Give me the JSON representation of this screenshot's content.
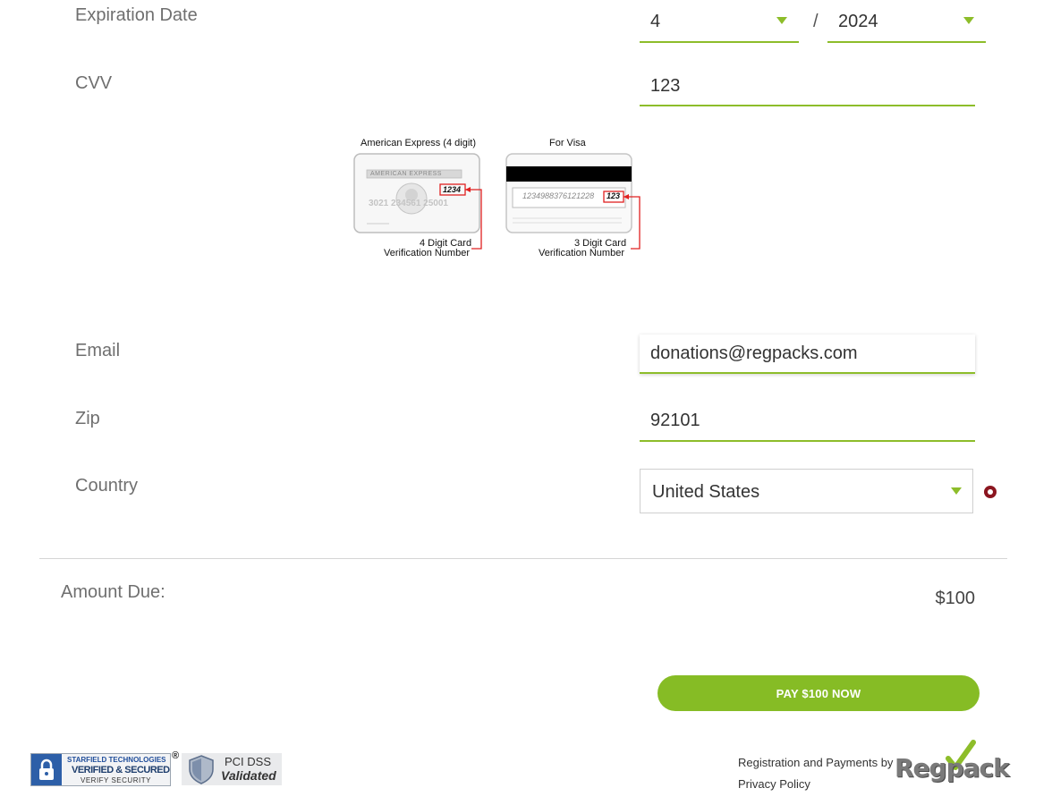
{
  "expiration": {
    "label": "Expiration Date",
    "month": "4",
    "separator": "/",
    "year": "2024"
  },
  "cvv": {
    "label": "CVV",
    "value": "123",
    "amex_title": "American Express (4 digit)",
    "amex_header": "AMERICAN EXPRESS",
    "amex_code": "1234",
    "amex_number": "3021  234561  25001",
    "amex_caption_1": "4 Digit Card",
    "amex_caption_2": "Verification Number",
    "visa_title": "For Visa",
    "visa_number": "1234988376121228",
    "visa_code": "123",
    "visa_caption_1": "3 Digit Card",
    "visa_caption_2": "Verification Number"
  },
  "email": {
    "label": "Email",
    "value": "donations@regpacks.com"
  },
  "zip": {
    "label": "Zip",
    "value": "92101"
  },
  "country": {
    "label": "Country",
    "value": "United States"
  },
  "amount": {
    "label": "Amount Due:",
    "value": "$100"
  },
  "pay_button": "PAY $100 NOW",
  "badges": {
    "starfield_line1": "STARFIELD TECHNOLOGIES",
    "starfield_line2": "VERIFIED & SECURED",
    "starfield_line3": "VERIFY SECURITY",
    "registered_mark": "®",
    "pci_line1": "PCI DSS",
    "pci_line2": "Validated"
  },
  "footer": {
    "powered_by": "Registration and Payments by",
    "privacy": "Privacy Policy",
    "logo_text": "Regpack"
  },
  "colors": {
    "accent": "#86bc25",
    "required": "#8b1620"
  }
}
